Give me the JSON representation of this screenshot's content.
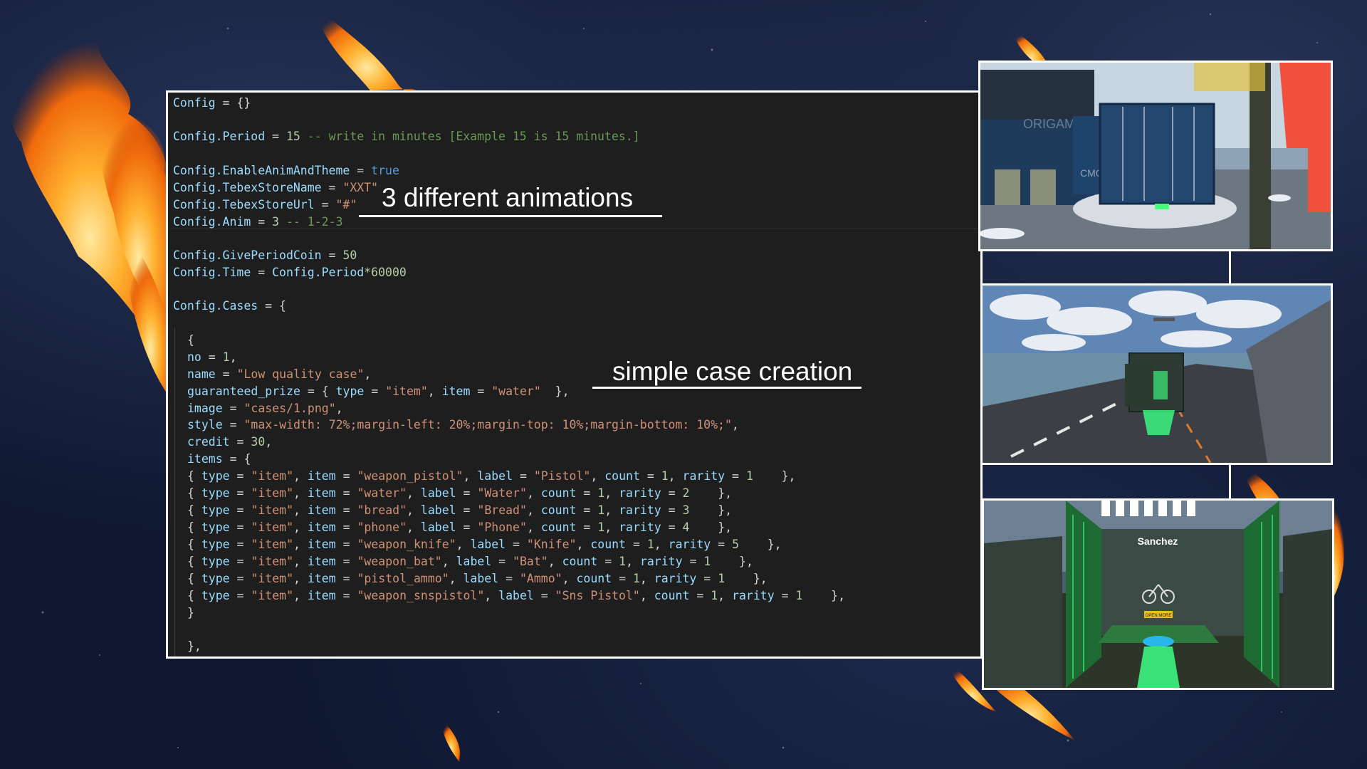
{
  "colors": {
    "background": "#0f1830",
    "editor_background": "#1e1e1e",
    "frame_border": "#ffffff",
    "syntax_variable": "#9cdcfe",
    "syntax_string": "#ce9178",
    "syntax_number": "#b5cea8",
    "syntax_comment": "#6a9955",
    "syntax_keyword": "#569cd6",
    "flame_orange": "#ff8a1a"
  },
  "callouts": {
    "animations": "3 different animations",
    "case_creation": "simple case creation"
  },
  "code": {
    "config_root": "Config",
    "config_root_value": "{}",
    "period_key": "Config.Period",
    "period_value": "15",
    "period_comment": "-- write in minutes [Example 15 is 15 minutes.]",
    "enable_anim_key": "Config.EnableAnimAndTheme",
    "enable_anim_value": "true",
    "store_name_key": "Config.TebexStoreName",
    "store_name_value": "\"XXT\"",
    "store_url_key": "Config.TebexStoreUrl",
    "store_url_value": "\"#\"",
    "anim_key": "Config.Anim",
    "anim_value": "3",
    "anim_comment": "-- 1-2-3",
    "give_coin_key": "Config.GivePeriodCoin",
    "give_coin_value": "50",
    "time_key": "Config.Time",
    "time_expr_var": "Config.Period",
    "time_expr_num": "*60000",
    "cases_key": "Config.Cases",
    "brace_open": "{",
    "no_key": "no",
    "no_value": "1",
    "name_key": "name",
    "name_value": "\"Low quality case\"",
    "guaranteed_key": "guaranteed_prize",
    "guaranteed_type_value": "\"item\"",
    "guaranteed_item_value": "\"water\"",
    "image_key": "image",
    "image_value": "\"cases/1.png\"",
    "style_key": "style",
    "style_value": "\"max-width: 72%;margin-left: 20%;margin-top: 10%;margin-bottom: 10%;\"",
    "credit_key": "credit",
    "credit_value": "30",
    "items_key": "items",
    "items": [
      {
        "item": "\"weapon_pistol\"",
        "label": "\"Pistol\"",
        "count": "1",
        "rarity": "1",
        "pad": "    "
      },
      {
        "item": "\"water\"",
        "label": "\"Water\"",
        "count": "1",
        "rarity": "2",
        "pad": "    "
      },
      {
        "item": "\"bread\"",
        "label": "\"Bread\"",
        "count": "1",
        "rarity": "3",
        "pad": "    "
      },
      {
        "item": "\"phone\"",
        "label": "\"Phone\"",
        "count": "1",
        "rarity": "4",
        "pad": "    "
      },
      {
        "item": "\"weapon_knife\"",
        "label": "\"Knife\"",
        "count": "1",
        "rarity": "5",
        "pad": "    "
      },
      {
        "item": "\"weapon_bat\"",
        "label": "\"Bat\"",
        "count": "1",
        "rarity": "1",
        "pad": "    "
      },
      {
        "item": "\"pistol_ammo\"",
        "label": "\"Ammo\"",
        "count": "1",
        "rarity": "1",
        "pad": "    "
      },
      {
        "item": "\"weapon_snspistol\"",
        "label": "\"Sns Pistol\"",
        "count": "1",
        "rarity": "1",
        "pad": "    "
      }
    ],
    "items_type_value": "\"item\"",
    "close_items": "}",
    "close_case": "},",
    "trailing_brace": "{"
  },
  "screenshots": {
    "container_text_1": "ORIGAMON",
    "container_text_2": "CMON",
    "preview_player_name": "Sanchez",
    "preview_button": "OPEN MORE"
  }
}
